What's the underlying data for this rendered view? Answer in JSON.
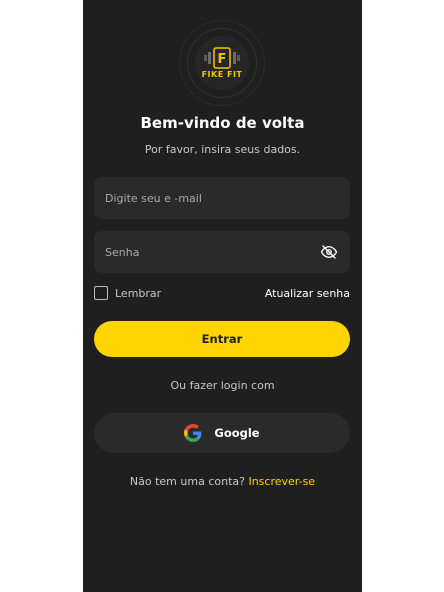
{
  "brand": {
    "name": "FIKE FIT",
    "logo_letter": "F",
    "accent": "#ffd400"
  },
  "login": {
    "title": "Bem-vindo de volta",
    "subtitle": "Por favor, insira seus dados.",
    "email_placeholder": "Digite seu e -mail",
    "email_value": "",
    "password_placeholder": "Senha",
    "password_value": "",
    "remember_label": "Lembrar",
    "remember_checked": false,
    "update_password": "Atualizar senha",
    "submit_label": "Entrar",
    "or_text": "Ou fazer login com",
    "google_label": "Google",
    "signup_prompt": "Não tem uma conta?",
    "signup_link": "Inscrever-se"
  },
  "icons": {
    "password_toggle": "eye-off-icon",
    "google": "google-icon",
    "checkbox": "checkbox-icon"
  },
  "colors": {
    "background": "#1f1f1f",
    "field": "#2a2a2a",
    "primary_button": "#ffd400",
    "link": "#ffd400"
  }
}
